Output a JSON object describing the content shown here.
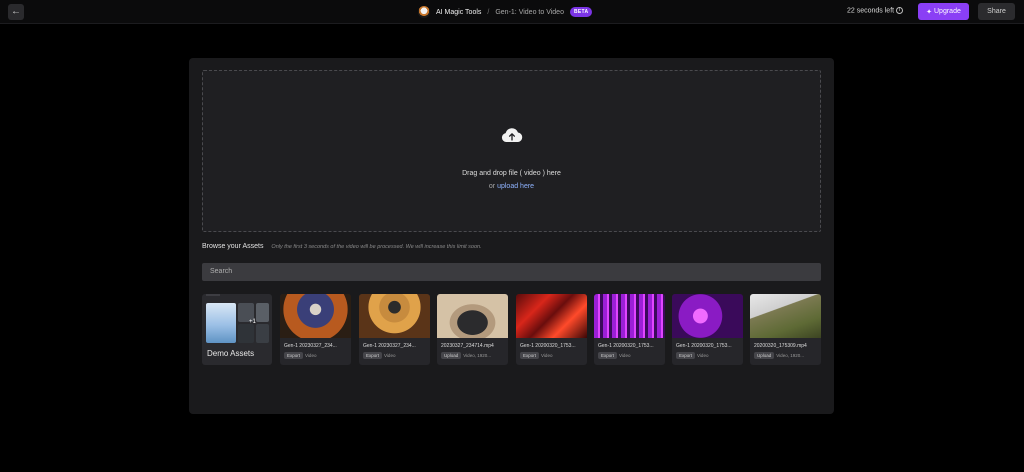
{
  "header": {
    "back_icon": "arrow-left-icon",
    "app_name": "AI Magic Tools",
    "separator": "/",
    "page_name": "Gen-1: Video to Video",
    "badge": "BETA",
    "timer": "22 seconds left",
    "upgrade_label": "Upgrade",
    "share_label": "Share"
  },
  "upload": {
    "icon": "cloud-upload-icon",
    "drag_text": "Drag and drop file ( video ) here",
    "or_text": "or",
    "link_text": "upload here"
  },
  "browse": {
    "title": "Browse your Assets",
    "note": "Only the first 3 seconds of the video will be processed. We will increase this limit soon.",
    "search_placeholder": "Search"
  },
  "demo_folder": {
    "label": "Demo Assets",
    "plus": "+1"
  },
  "assets": [
    {
      "name": "Gen-1 20230327_234...",
      "tag": "Export",
      "meta": "Video"
    },
    {
      "name": "Gen-1 20230327_234...",
      "tag": "Export",
      "meta": "Video"
    },
    {
      "name": "20230327_234714.mp4",
      "tag": "Upload",
      "meta": "Video, 1920..."
    },
    {
      "name": "Gen-1 20200320_1753...",
      "tag": "Export",
      "meta": "Video"
    },
    {
      "name": "Gen-1 20200320_1753...",
      "tag": "Export",
      "meta": "Video"
    },
    {
      "name": "Gen-1 20200320_1753...",
      "tag": "Export",
      "meta": "Video"
    },
    {
      "name": "20200320_175309.mp4",
      "tag": "Upload",
      "meta": "Video, 1920..."
    }
  ],
  "colors": {
    "accent": "#8a3ff5",
    "badge": "#7b34e6",
    "link": "#8fb3ff"
  }
}
